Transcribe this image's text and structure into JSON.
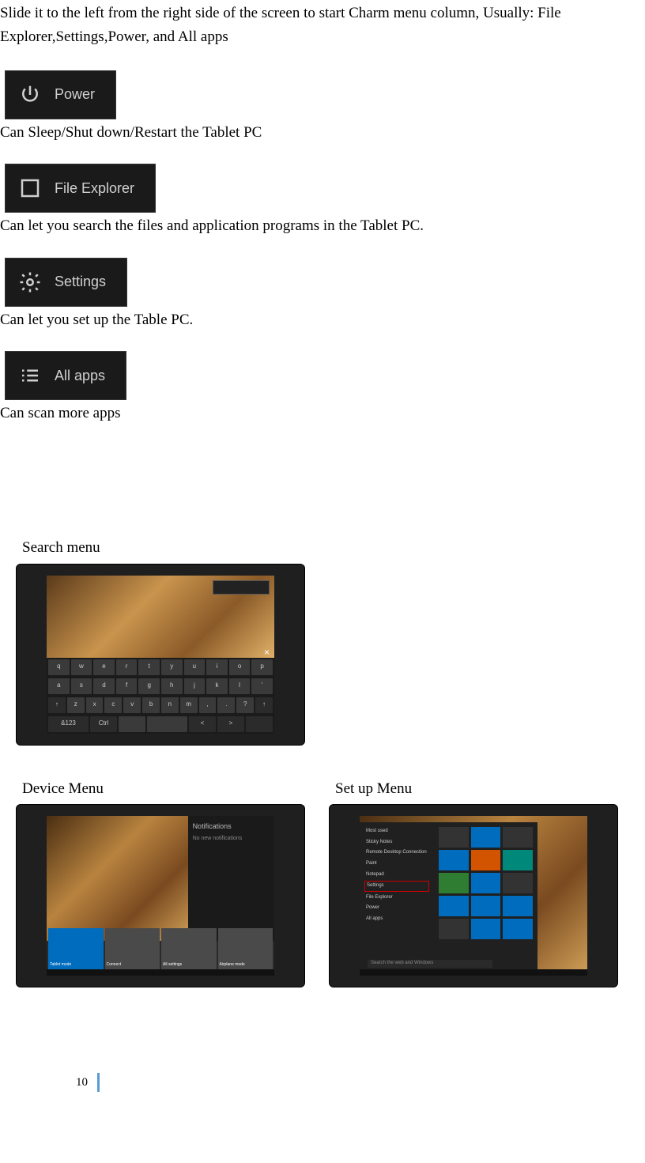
{
  "intro": "Slide it to the left from the right side of the screen to start Charm menu column, Usually: File Explorer,Settings,Power, and All apps",
  "items": {
    "power": {
      "label": "Power",
      "desc": "Can Sleep/Shut down/Restart the Tablet PC"
    },
    "explorer": {
      "label": "File Explorer",
      "desc": "Can let you search the files and application programs in the Tablet PC."
    },
    "settings": {
      "label": "Settings",
      "desc": "Can let you set up the Table PC."
    },
    "allapps": {
      "label": "All apps",
      "desc": "Can scan more apps"
    }
  },
  "sections": {
    "search": "Search menu",
    "device": "Device Menu",
    "setup": "Set up Menu"
  },
  "keyboard": {
    "row1": [
      "q",
      "w",
      "e",
      "r",
      "t",
      "y",
      "u",
      "i",
      "o",
      "p"
    ],
    "row2": [
      "a",
      "s",
      "d",
      "f",
      "g",
      "h",
      "j",
      "k",
      "l",
      "'"
    ],
    "row3": [
      "↑",
      "z",
      "x",
      "c",
      "v",
      "b",
      "n",
      "m",
      ",",
      ".",
      "?",
      "↑"
    ],
    "row4": [
      "&123",
      "Ctrl",
      "",
      "",
      "<",
      ">",
      ""
    ]
  },
  "device_panel": {
    "title": "Notifications",
    "subtitle": "No new notifications",
    "tiles": [
      "Tablet mode",
      "Connect",
      "All settings",
      "Airplane mode"
    ]
  },
  "setup_panel": {
    "left_items": [
      "Most used",
      "Sticky Notes",
      "Remote Desktop Connection",
      "Paint",
      "Notepad",
      "Settings",
      "File Explorer",
      "Power",
      "All apps"
    ],
    "highlight_index": 5,
    "search_placeholder": "Search the web and Windows"
  },
  "page_number": "10"
}
